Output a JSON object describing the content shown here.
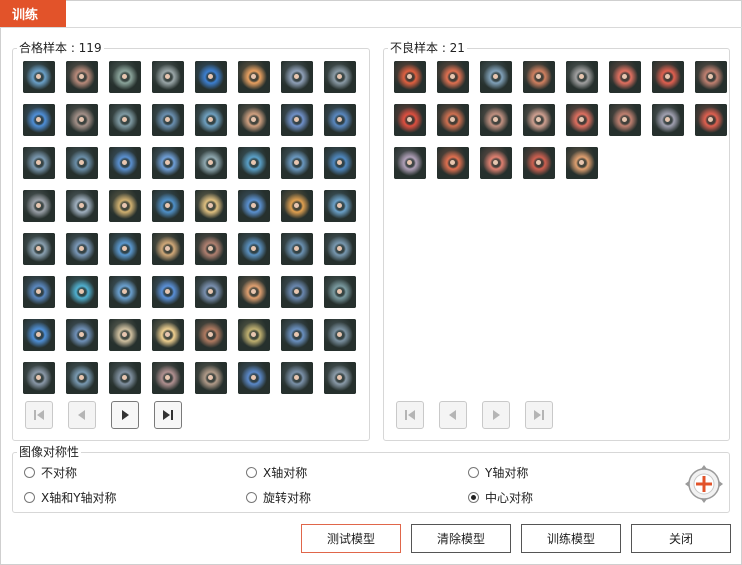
{
  "window": {
    "title": "训练"
  },
  "good_samples": {
    "label": "合格样本 : 119",
    "thumbs": [
      "#6aa0c8",
      "#b88a7a",
      "#8aa39a",
      "#9aa6a8",
      "#3c7fd0",
      "#e8a060",
      "#8fa0b8",
      "#8a9aa5",
      "#4f8fd8",
      "#a39088",
      "#7f9aa3",
      "#6a8fb0",
      "#6fa0c0",
      "#d0a080",
      "#6f90c8",
      "#5a88c0",
      "#7a98b0",
      "#6b8ea8",
      "#5a90d0",
      "#6f9fd8",
      "#8fa8b0",
      "#5aa0c8",
      "#6a98c0",
      "#4f88c0",
      "#9aa0a8",
      "#a0b0c0",
      "#d0b070",
      "#4f90c8",
      "#e0c080",
      "#5a90d0",
      "#e0a050",
      "#6aa0c8",
      "#8aa0b0",
      "#7a98b8",
      "#5a98d0",
      "#d0a878",
      "#b08070",
      "#5a90c0",
      "#6a90b0",
      "#7898b0",
      "#5a88c0",
      "#50b0d0",
      "#6aa0d0",
      "#5a90d8",
      "#7a90b0",
      "#e0a070",
      "#6a88b0",
      "#7a9aa0",
      "#4f90d8",
      "#6f90b8",
      "#d0c0a0",
      "#f0d090",
      "#b07a60",
      "#c0b070",
      "#6a90c0",
      "#7a90a0",
      "#8a98a8",
      "#7898b0",
      "#8090a0",
      "#b09090",
      "#b09a88",
      "#5a88c8",
      "#7a90a8",
      "#8a9aa8"
    ],
    "nav": [
      "first-page",
      "prev-page",
      "next-page",
      "last-page"
    ]
  },
  "bad_samples": {
    "label": "不良样本 : 21",
    "thumbs": [
      "#e06040",
      "#e07050",
      "#80a0b8",
      "#d08060",
      "#a0a0a0",
      "#e07060",
      "#e06050",
      "#c08070",
      "#e05040",
      "#d07050",
      "#c09080",
      "#d0a090",
      "#e07060",
      "#c08070",
      "#a0a0b0",
      "#e06050",
      "#b0a0b8",
      "#e07050",
      "#e08070",
      "#d06050",
      "#e0a070"
    ],
    "nav": [
      "first-page",
      "prev-page",
      "next-page",
      "last-page"
    ]
  },
  "symmetry": {
    "label": "图像对称性",
    "options": [
      {
        "label": "不对称",
        "checked": false
      },
      {
        "label": "X轴对称",
        "checked": false
      },
      {
        "label": "Y轴对称",
        "checked": false
      },
      {
        "label": "X轴和Y轴对称",
        "checked": false
      },
      {
        "label": "旋转对称",
        "checked": false
      },
      {
        "label": "中心对称",
        "checked": true
      }
    ]
  },
  "buttons": {
    "test": "测试模型",
    "clear": "清除模型",
    "train": "训练模型",
    "close": "关闭"
  },
  "colors": {
    "accent": "#e2532a"
  }
}
